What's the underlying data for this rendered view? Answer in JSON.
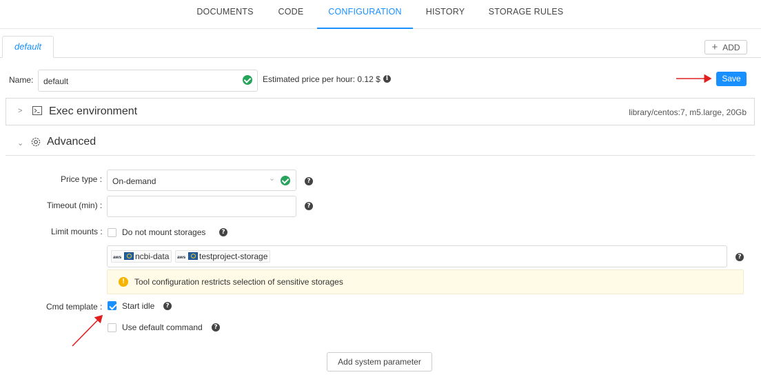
{
  "nav": {
    "tabs": [
      "DOCUMENTS",
      "CODE",
      "CONFIGURATION",
      "HISTORY",
      "STORAGE RULES"
    ],
    "active_index": 2
  },
  "config_tab": {
    "label": "default",
    "add_label": "ADD"
  },
  "name_row": {
    "label": "Name:",
    "value": "default",
    "price_text": "Estimated price per hour: 0.12 $",
    "save_label": "Save"
  },
  "exec_env": {
    "title": "Exec environment",
    "summary": "library/centos:7,  m5.large,  20Gb"
  },
  "advanced": {
    "title": "Advanced",
    "price_type": {
      "label": "Price type",
      "value": "On-demand"
    },
    "timeout": {
      "label": "Timeout (min)",
      "value": ""
    },
    "limit_mounts": {
      "label": "Limit mounts",
      "checkbox_label": "Do not mount storages",
      "tags": [
        {
          "provider": "aws",
          "name": "ncbi-data"
        },
        {
          "provider": "aws",
          "name": "testproject-storage"
        }
      ],
      "warning": "Tool configuration restricts selection of sensitive storages"
    },
    "cmd_template": {
      "label": "Cmd template",
      "start_idle_label": "Start idle",
      "start_idle_checked": true,
      "default_command_label": "Use default command",
      "default_command_checked": false
    },
    "add_system_param_label": "Add system parameter"
  },
  "colors": {
    "accent": "#1890ff",
    "success": "#27a45b",
    "warning": "#f5b400",
    "annotation": "#e02020"
  },
  "icons": [
    "chevron-right-icon",
    "terminal-icon",
    "chevron-down-icon",
    "gear-icon",
    "check-circle-icon",
    "info-icon",
    "question-icon",
    "warning-icon",
    "plus-icon"
  ]
}
